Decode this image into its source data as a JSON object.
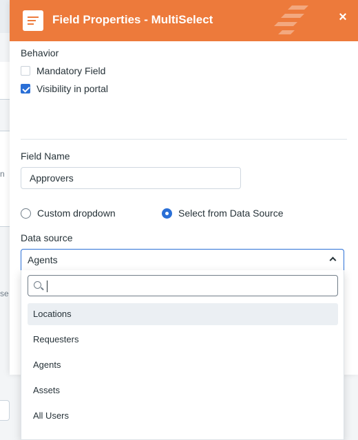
{
  "modal": {
    "title": "Field Properties - MultiSelect",
    "close_label": "×"
  },
  "behavior": {
    "label": "Behavior",
    "options": [
      {
        "label": "Mandatory Field",
        "checked": false
      },
      {
        "label": "Visibility in portal",
        "checked": true
      }
    ]
  },
  "field_name": {
    "label": "Field Name",
    "value": "Approvers"
  },
  "source_type": {
    "options": [
      {
        "label": "Custom dropdown",
        "selected": false
      },
      {
        "label": "Select from Data Source",
        "selected": true
      }
    ]
  },
  "data_source": {
    "label": "Data source",
    "selected": "Agents",
    "search_value": "",
    "options": [
      {
        "label": "Locations",
        "highlighted": true
      },
      {
        "label": "Requesters",
        "highlighted": false
      },
      {
        "label": "Agents",
        "highlighted": false
      },
      {
        "label": "Assets",
        "highlighted": false
      },
      {
        "label": "All Users",
        "highlighted": false
      }
    ]
  },
  "background": {
    "fragment_1": "n",
    "fragment_2": "se"
  },
  "colors": {
    "header": "#ed7a3b",
    "accent": "#2a6fd6"
  },
  "icons": {
    "header": "form-field-icon",
    "close": "close-icon",
    "search": "search-icon",
    "chevron": "chevron-up-icon"
  }
}
